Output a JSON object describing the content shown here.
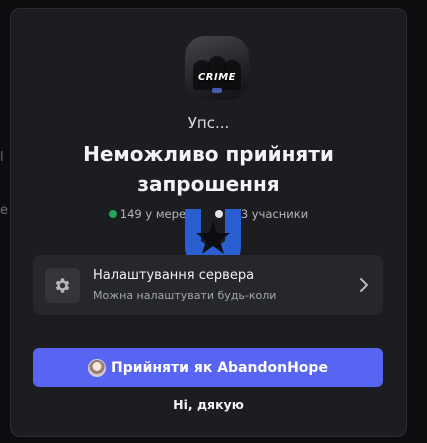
{
  "invite": {
    "server_icon_text": "CRIME",
    "subtitle": "Упс...",
    "headline": "Неможливо прийняти запрошення",
    "online_label": "149 у мережі",
    "members_label": "503 учасники"
  },
  "settings_row": {
    "title": "Налаштування сервера",
    "subtitle": "Можна налаштувати будь-коли",
    "icon": "gear-icon"
  },
  "actions": {
    "accept_label": "Прийняти як AbandonHope",
    "decline_label": "Ні, дякую"
  },
  "colors": {
    "accent": "#5865f2",
    "online": "#23a55a",
    "modal_bg": "#1c1d21",
    "watermark": "#2a5fd2"
  }
}
